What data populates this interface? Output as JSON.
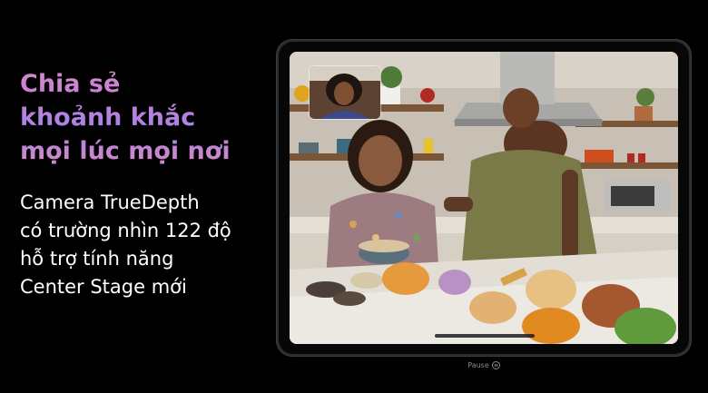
{
  "headline": {
    "line1": "Chia sẻ",
    "line2": "khoảnh khắc",
    "line3": "mọi lúc mọi nơi"
  },
  "body": {
    "line1": "Camera TrueDepth",
    "line2": "có trường nhìn 122 độ",
    "line3": "hỗ trợ tính năng",
    "line4": "Center Stage mới"
  },
  "video_control": {
    "label": "Pause",
    "icon": "pause-circle-icon"
  },
  "colors": {
    "background": "#000000",
    "headline_gradient": [
      "#d68bc6",
      "#a784e6"
    ],
    "body_text": "#ffffff"
  }
}
